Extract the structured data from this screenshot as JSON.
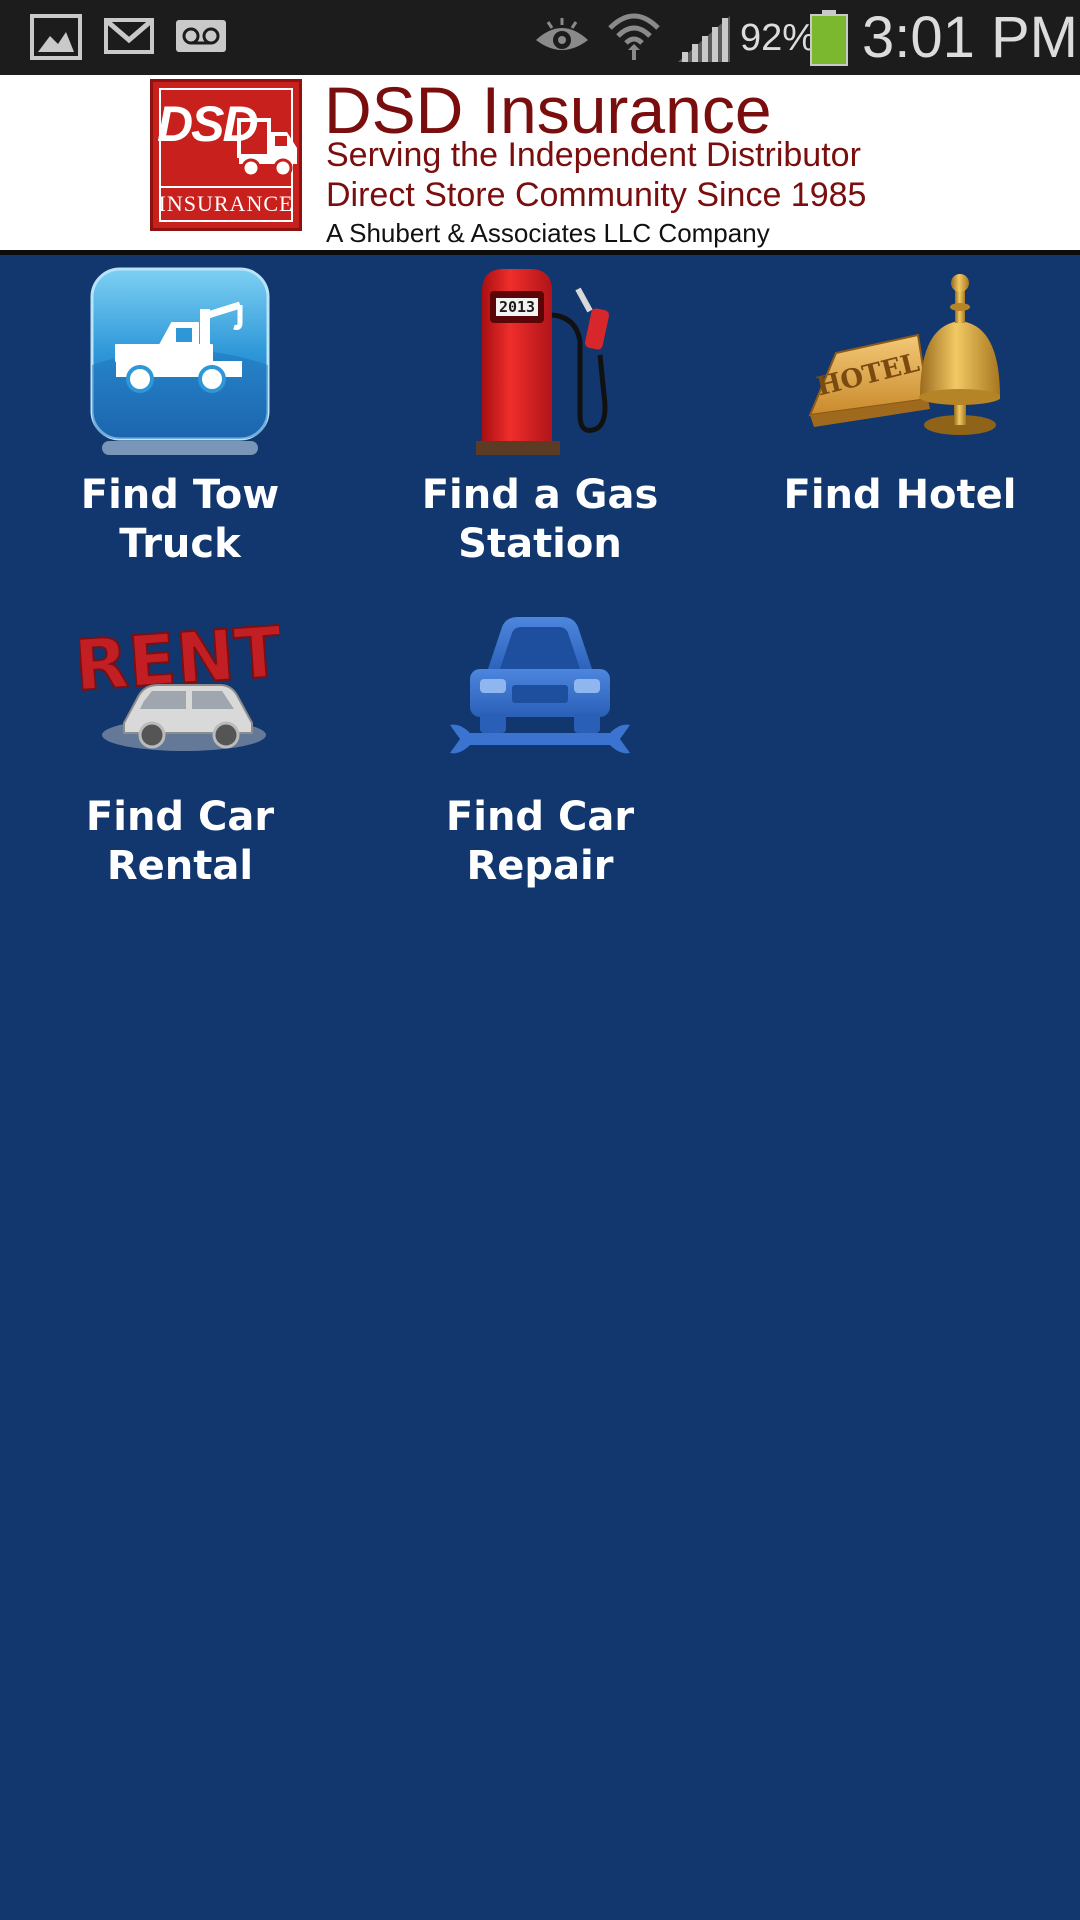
{
  "status_bar": {
    "icons": [
      "gallery-icon",
      "gmail-icon",
      "voicemail-icon",
      "eye-icon",
      "wifi-icon",
      "signal-icon",
      "battery-icon"
    ],
    "battery_percent": "92%",
    "time": "3:01 PM",
    "battery_color": "#7cb82f"
  },
  "header": {
    "logo": {
      "mark_text": "DSD",
      "mark_subtext": "INSURANCE"
    },
    "title": "DSD Insurance",
    "tagline_1": "Serving the Independent Distributor",
    "tagline_2": "Direct Store Community Since 1985",
    "company_line": "A Shubert & Associates LLC Company",
    "brand_color": "#7a0d0d"
  },
  "background_color": "#11376e",
  "menu": {
    "tiles": [
      {
        "label": "Find Tow\nTruck",
        "icon": "tow-truck-icon"
      },
      {
        "label": "Find a Gas\nStation",
        "icon": "gas-pump-icon"
      },
      {
        "label": "Find Hotel",
        "icon": "hotel-bell-icon"
      },
      {
        "label": "Find Car\nRental",
        "icon": "rent-car-icon"
      },
      {
        "label": "Find Car\nRepair",
        "icon": "car-repair-icon"
      }
    ],
    "gas_pump_counter": "2013",
    "hotel_sign_text": "HOTEL",
    "rent_sign_text": "RENT"
  }
}
